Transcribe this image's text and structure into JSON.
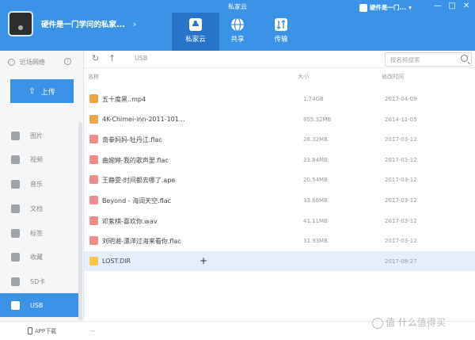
{
  "app": {
    "title": "私家云"
  },
  "device": {
    "name": "硬件是一门学问的私家..."
  },
  "nav_tabs": [
    {
      "label": "私家云",
      "icon": "cloud-icon",
      "active": true
    },
    {
      "label": "共享",
      "icon": "globe-icon",
      "active": false
    },
    {
      "label": "传输",
      "icon": "transfer-icon",
      "active": false
    }
  ],
  "user": {
    "name": "硬件是一门..."
  },
  "window_controls": {
    "min": "—",
    "max": "□",
    "close": "✕"
  },
  "sidebar": {
    "nearby_label": "近场网络",
    "upload_label": "上传",
    "items": [
      {
        "label": "图片",
        "icon": "image-icon",
        "active": false
      },
      {
        "label": "视频",
        "icon": "video-icon",
        "active": false
      },
      {
        "label": "音乐",
        "icon": "music-icon",
        "active": false
      },
      {
        "label": "文档",
        "icon": "document-icon",
        "active": false
      },
      {
        "label": "标签",
        "icon": "tag-icon",
        "active": false
      },
      {
        "label": "收藏",
        "icon": "heart-icon",
        "active": false
      },
      {
        "label": "SD卡",
        "icon": "sd-card-icon",
        "active": false
      },
      {
        "label": "USB",
        "icon": "usb-icon",
        "active": true
      }
    ],
    "app_download": "APP下载"
  },
  "toolbar": {
    "refresh": "↻",
    "up": "↑",
    "breadcrumb": "USB",
    "search_placeholder": "按名称搜索"
  },
  "columns": {
    "name": "名称",
    "size": "大小",
    "modified": "修改时间"
  },
  "files": [
    {
      "name": "五十度黑..mp4",
      "size": "1.74GB",
      "date": "2017-04-09",
      "type": "video",
      "selected": false
    },
    {
      "name": "4K-Chimei-inn-2011-101...",
      "size": "855.32MB",
      "date": "2014-11-05",
      "type": "video",
      "selected": false
    },
    {
      "name": "南拳妈妈-牡丹江.flac",
      "size": "26.32MB",
      "date": "2017-03-12",
      "type": "music",
      "selected": false
    },
    {
      "name": "曲婉婷-我的歌声里.flac",
      "size": "23.84MB",
      "date": "2017-03-12",
      "type": "music",
      "selected": false
    },
    {
      "name": "王静雯-时间都去哪了.ape",
      "size": "20.54MB",
      "date": "2017-03-12",
      "type": "music",
      "selected": false
    },
    {
      "name": "Beyond - 海阔天空.flac",
      "size": "33.66MB",
      "date": "2017-03-12",
      "type": "music",
      "selected": false
    },
    {
      "name": "邓紫棋-喜欢你.wav",
      "size": "41.11MB",
      "date": "2017-03-12",
      "type": "music",
      "selected": false
    },
    {
      "name": "刘明湘-漂洋过海来看你.flac",
      "size": "31.93MB",
      "date": "2017-03-12",
      "type": "music",
      "selected": false
    },
    {
      "name": "LOST.DIR",
      "size": "",
      "date": "2017-08-27",
      "type": "folder",
      "selected": true
    }
  ],
  "status": {
    "text": "--"
  },
  "watermark": "值 什么值得买",
  "colors": {
    "accent": "#3a93e6",
    "selected_row": "#e4effb"
  }
}
